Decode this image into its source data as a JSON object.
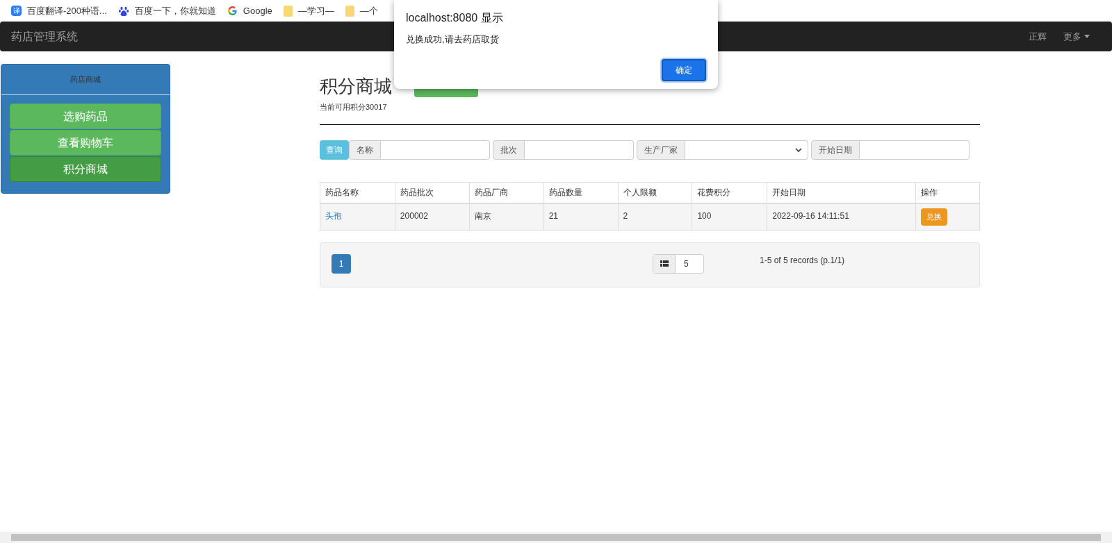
{
  "bookmarks": [
    {
      "kind": "translate",
      "icon_text": "译",
      "label": "百度翻译-200种语..."
    },
    {
      "kind": "baidu",
      "label": "百度一下，你就知道"
    },
    {
      "kind": "google",
      "label": "Google"
    },
    {
      "kind": "folder",
      "label": "—学习—"
    },
    {
      "kind": "folder",
      "label": "—个"
    }
  ],
  "navbar": {
    "brand": "药店管理系统",
    "items": [
      {
        "label": "正辉",
        "dropdown": false
      },
      {
        "label": "更多",
        "dropdown": true
      }
    ]
  },
  "sidebar": {
    "header": "药店商城",
    "items": [
      {
        "label": "选购药品",
        "selected": false
      },
      {
        "label": "查看购物车",
        "selected": false
      },
      {
        "label": "积分商城",
        "selected": true
      }
    ]
  },
  "page": {
    "title": "积分商城",
    "points": "当前可用积分30017"
  },
  "search": {
    "button": "查询",
    "fields": [
      {
        "label": "名称",
        "kind": "text"
      },
      {
        "label": "批次",
        "kind": "text"
      },
      {
        "label": "生产厂家",
        "kind": "select"
      },
      {
        "label": "开始日期",
        "kind": "text"
      }
    ]
  },
  "table": {
    "columns": [
      "药品名称",
      "药品批次",
      "药品厂商",
      "药品数量",
      "个人限额",
      "花费积分",
      "开始日期",
      "操作"
    ],
    "rows": [
      {
        "cells": [
          "头孢",
          "200002",
          "南京",
          "21",
          "2",
          "100",
          "2022-09-16 14:11:51"
        ],
        "action": "兑换"
      }
    ]
  },
  "pagination": {
    "pages": [
      {
        "label": "1",
        "selected": true
      }
    ],
    "page_size": "5",
    "summary": "1-5 of 5 records (p.1/1)"
  },
  "dialog": {
    "title": "localhost:8080 显示",
    "message": "兑换成功,请去药店取货",
    "button": "确定"
  }
}
